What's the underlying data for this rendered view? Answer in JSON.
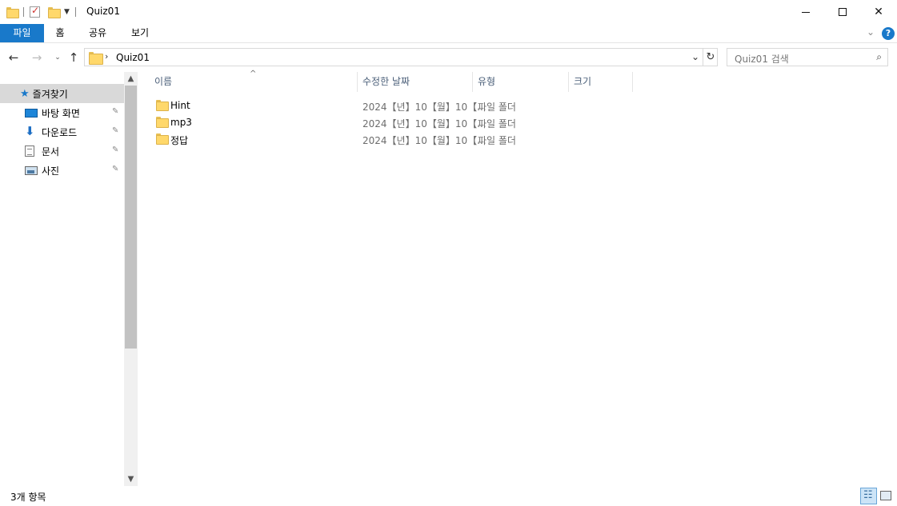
{
  "window": {
    "title": "Quiz01",
    "minimize_icon": "minimize-icon",
    "maximize_icon": "maximize-icon",
    "close_glyph": "✕"
  },
  "ribbon": {
    "tabs": [
      "파일",
      "홈",
      "공유",
      "보기"
    ],
    "collapse_glyph": "⌄",
    "help_glyph": "?"
  },
  "address": {
    "path": "Quiz01",
    "separator": "›",
    "refresh_glyph": "↻",
    "dropdown_glyph": "⌄"
  },
  "nav": {
    "back": "←",
    "forward": "→",
    "recent": "⌄",
    "up": "↑"
  },
  "search": {
    "placeholder": "Quiz01 검색",
    "icon_glyph": "⌕"
  },
  "sidebar": {
    "quick_access": "즐겨찾기",
    "items": [
      {
        "label": "바탕 화면",
        "icon": "desktop-icon"
      },
      {
        "label": "다운로드",
        "icon": "download-icon"
      },
      {
        "label": "문서",
        "icon": "documents-icon"
      },
      {
        "label": "사진",
        "icon": "pictures-icon"
      }
    ],
    "pin_glyph": "📌"
  },
  "columns": {
    "name": "이름",
    "date": "수정한 날짜",
    "type": "유형",
    "size": "크기",
    "sort_caret": "^"
  },
  "files": [
    {
      "name": "Hint",
      "date": "2024【년】10【월】10【...",
      "type": "파일 폴더"
    },
    {
      "name": "mp3",
      "date": "2024【년】10【월】10【...",
      "type": "파일 폴더"
    },
    {
      "name": "정답",
      "date": "2024【년】10【월】10【...",
      "type": "파일 폴더"
    }
  ],
  "status": {
    "count": "3개 항목"
  },
  "colors": {
    "accent": "#1979ca",
    "selected_nav": "#d9d9d9",
    "folder": "#ffd86b"
  }
}
